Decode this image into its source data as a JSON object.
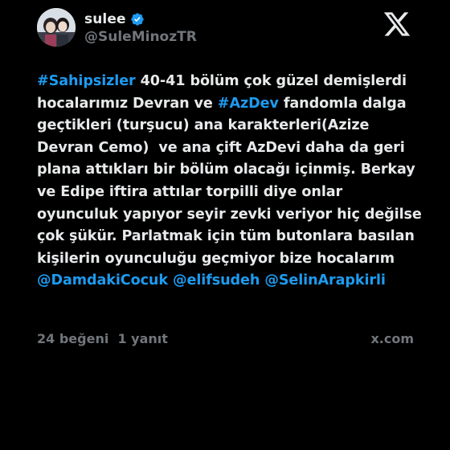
{
  "author": {
    "display_name": "sulee",
    "handle": "@SuleMinozTR",
    "verified_icon": "verified-badge-icon",
    "avatar_icon": "avatar"
  },
  "colors": {
    "background": "#000000",
    "text": "#e7e9ea",
    "muted": "#71767b",
    "link": "#1d9bf0"
  },
  "tweet": {
    "segments": [
      {
        "text": "#Sahipsizler",
        "type": "link"
      },
      {
        "text": " 40-41 bölüm çok güzel demişlerdi hocalarımız Devran ve ",
        "type": "text"
      },
      {
        "text": "#AzDev",
        "type": "link"
      },
      {
        "text": " fandomla dalga geçtikleri (turşucu) ana karakterleri(Azize Devran Cemo)  ve ana çift AzDevi daha da geri plana attıkları bir bölüm olacağı içinmiş. Berkay ve Edipe iftira attılar torpilli diye onlar oyunculuk yapıyor seyir zevki veriyor hiç değilse çok şükür. Parlatmak için tüm butonlara basılan kişilerin oyunculuğu geçmiyor bize hocalarım ",
        "type": "text"
      },
      {
        "text": "@DamdakiCocuk",
        "type": "link"
      },
      {
        "text": " ",
        "type": "text"
      },
      {
        "text": "@elifsudeh",
        "type": "link"
      },
      {
        "text": " ",
        "type": "text"
      },
      {
        "text": "@SelinArapkirli",
        "type": "link"
      }
    ]
  },
  "footer": {
    "stats": "24 beğeni  1 yanıt",
    "site": "x.com"
  },
  "brand_icon": "x-logo-icon"
}
